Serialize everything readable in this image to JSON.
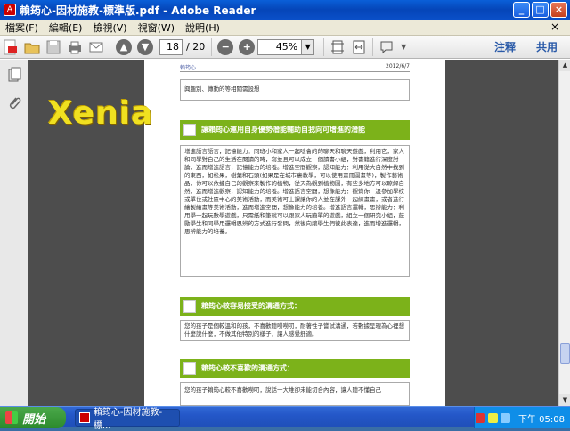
{
  "window": {
    "title": "賴筠心-因材施教-標準版.pdf - Adobe Reader",
    "app_icon_label": "A"
  },
  "window_controls": {
    "minimize": "_",
    "maximize": "□",
    "close": "×"
  },
  "menu": {
    "items": [
      "檔案(F)",
      "編輯(E)",
      "檢視(V)",
      "視窗(W)",
      "說明(H)"
    ],
    "close": "×"
  },
  "toolbar": {
    "page_current": "18",
    "page_total": "/ 20",
    "zoom": "45%",
    "zoom_dropdown": "▼",
    "comment_label": "注释",
    "share_label": "共用"
  },
  "overlay": {
    "watermark": "Xenia"
  },
  "document": {
    "header_left": "賴筠心",
    "header_right": "2012/6/7",
    "box1_text": "興趣別、傳動的等相關需設想",
    "section1_title": "讓賴筠心運用自身優勢潛能輔助自我向可增進的潛能",
    "section1_body": "增進語言語言，記憶能力：同班小和家人一起唸會的的聊天和聊天遊戲，利用它，家人和同學對自己的生活在閱讀的時，寫並且可以成立一個讀書小組，對書籍進行深度討論，進而增進語言，記憶能力的培養。增進空間觀察，認知能力：利用從大自然中找到的東西，如松果，樹葉和石頭(如果是在城市裏教學，可以使用畫冊圖畫等)，製作藝術品，你可以依據自己的觀察來製作的植物，從天為觀到植物園，有些多地方可以瞭解自然，進而增進觀察，認知能力的培養。增進語言空間，想像能力：觀賞你一邊參加學校或單位或社區中心的美術活動，而美術可上課讓你的人並在課外一起練畫畫，或者進行繪製繪畫等美術活動，進而增進空間，想像能力的培養。增進語言邏輯，思辨能力：利用學一起玩數學遊戲，只需紙和筆就可以跟家人玩簡單的遊戲，組立一個研究小組，鼓勵學生和同學用邏輯思辨的方式進行發問，然後向讓學生們彼此表達，進而增進邏輯，思辨能力的培養。",
    "section2_title": "賴筠心較容易接受的溝通方式：",
    "section2_body": "您的孩子是個較溫和的孩，不喜歡聽嘮嘮叨，耐著性子嘗試溝通，若數據呈現為心裡想什麼說什麼，不做其他特別的樣子，讓人感覺舒適。",
    "section3_title": "賴筠心較不喜歡的溝通方式：",
    "section3_body": "您的孩子賴筠心較不喜歡嘮叨，說話一大堆卻未能切合內容，讓人聽不懂自己"
  },
  "taskbar": {
    "start": "開始",
    "task_label": "賴筠心-因材施教-標...",
    "clock": "下午 05:08"
  },
  "colors": {
    "section_green": "#7cb21a",
    "viewer_bg": "#4d4d4d",
    "taskbar_blue": "#2457c8"
  }
}
